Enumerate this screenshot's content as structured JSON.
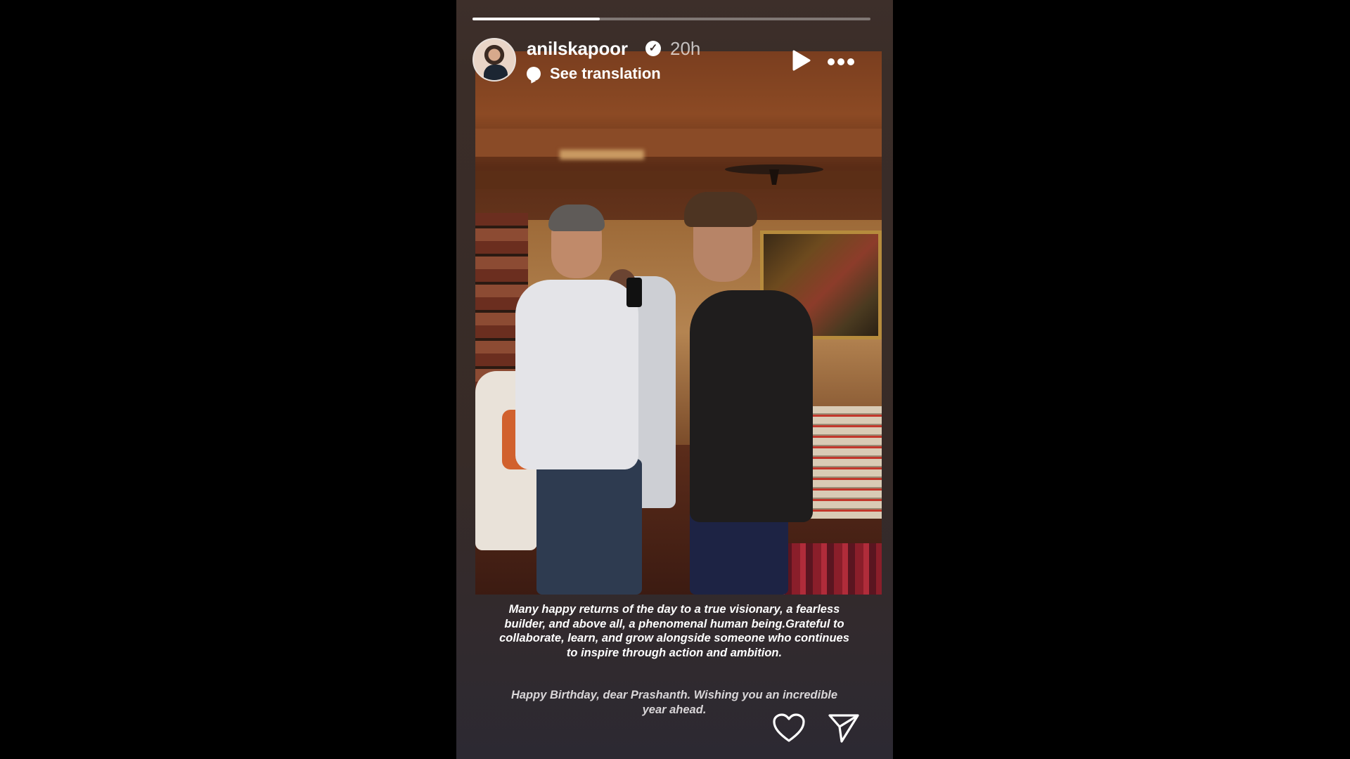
{
  "story": {
    "progress_fraction": 0.32,
    "author": {
      "username": "anilskapoor",
      "verified": true,
      "time_ago": "20h"
    },
    "translation_label": "See translation",
    "caption_line": "Many happy returns of the day to a true visionary, a fearless builder, and above all, a phenomenal human being.Grateful to collaborate, learn, and grow alongside someone who continues to inspire through action and ambition.",
    "caption_line2": "Happy Birthday, dear Prashanth. Wishing you an incredible year ahead.",
    "icons": {
      "play": "play-icon",
      "more": "more-icon",
      "like": "heart-icon",
      "share": "send-icon",
      "verified": "verified-badge-icon",
      "translate": "speech-bubble-icon"
    }
  }
}
